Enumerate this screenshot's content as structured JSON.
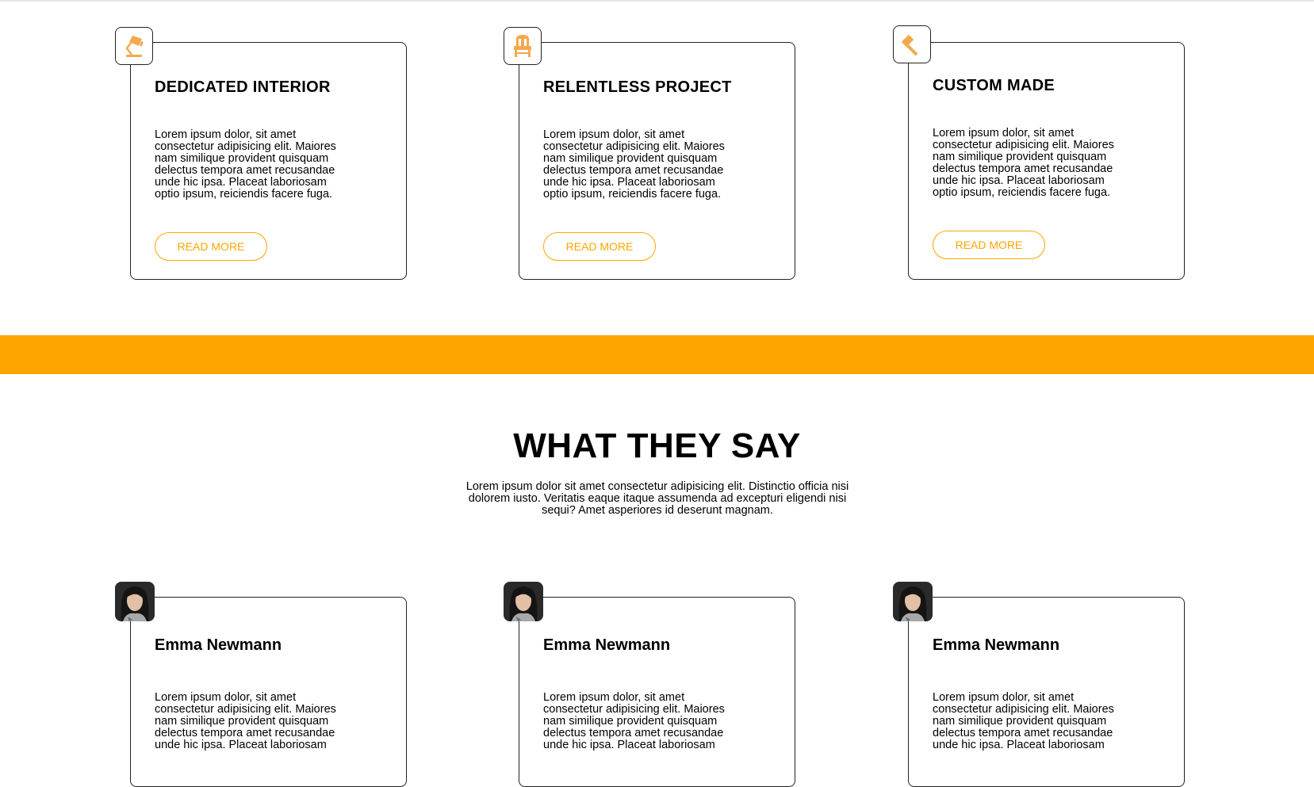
{
  "features": [
    {
      "icon": "desk-lamp-icon",
      "title": "DEDICATED INTERIOR",
      "text": "Lorem ipsum dolor, sit amet consectetur adipisicing elit. Maiores nam similique provident quisquam delectus tempora amet recusandae unde hic ipsa. Placeat laboriosam optio ipsum, reiciendis facere fuga.",
      "button": "READ MORE"
    },
    {
      "icon": "chair-icon",
      "title": "RELENTLESS PROJECT",
      "text": "Lorem ipsum dolor, sit amet consectetur adipisicing elit. Maiores nam similique provident quisquam delectus tempora amet recusandae unde hic ipsa. Placeat laboriosam optio ipsum, reiciendis facere fuga.",
      "button": "READ MORE"
    },
    {
      "icon": "hammer-icon",
      "title": "CUSTOM MADE",
      "text": "Lorem ipsum dolor, sit amet consectetur adipisicing elit. Maiores nam similique provident quisquam delectus tempora amet recusandae unde hic ipsa. Placeat laboriosam optio ipsum, reiciendis facere fuga.",
      "button": "READ MORE"
    }
  ],
  "testimonials": {
    "heading": "WHAT THEY SAY",
    "subtitle": "Lorem ipsum dolor sit amet consectetur adipisicing elit. Distinctio officia nisi dolorem iusto. Veritatis eaque itaque assumenda ad excepturi eligendi nisi sequi? Amet asperiores id deserunt magnam.",
    "items": [
      {
        "name": "Emma Newmann",
        "text": "Lorem ipsum dolor, sit amet consectetur adipisicing elit. Maiores nam similique provident quisquam delectus tempora amet recusandae unde hic ipsa. Placeat laboriosam"
      },
      {
        "name": "Emma Newmann",
        "text": "Lorem ipsum dolor, sit amet consectetur adipisicing elit. Maiores nam similique provident quisquam delectus tempora amet recusandae unde hic ipsa. Placeat laboriosam"
      },
      {
        "name": "Emma Newmann",
        "text": "Lorem ipsum dolor, sit amet consectetur adipisicing elit. Maiores nam similique provident quisquam delectus tempora amet recusandae unde hic ipsa. Placeat laboriosam"
      }
    ]
  },
  "colors": {
    "accent": "#FFA500",
    "icon": "#F2A94E",
    "border": "#222222"
  }
}
